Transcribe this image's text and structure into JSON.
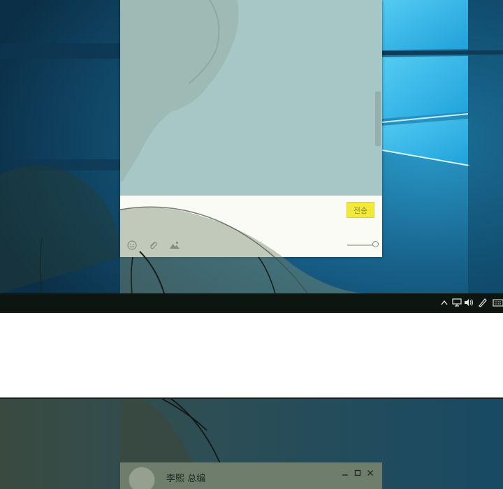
{
  "chat": {
    "send_label": "전송",
    "tools": [
      {
        "icon": "emoji-icon"
      },
      {
        "icon": "attachment-icon"
      },
      {
        "icon": "image-icon"
      }
    ],
    "font_size_slider_value": 1.0
  },
  "taskbar": {
    "tray_icons": [
      "chevron-up-icon",
      "network-icon",
      "volume-icon",
      "pen-icon",
      "keyboard-icon"
    ]
  },
  "second_panel": {
    "window_title": "李熙 总编",
    "controls": [
      "minimize-icon",
      "maximize-icon",
      "close-icon"
    ]
  },
  "colors": {
    "send_button": "#f3e93a",
    "desktop_blue": "#1c6f97",
    "chat_bg": "#a7c7c6"
  }
}
